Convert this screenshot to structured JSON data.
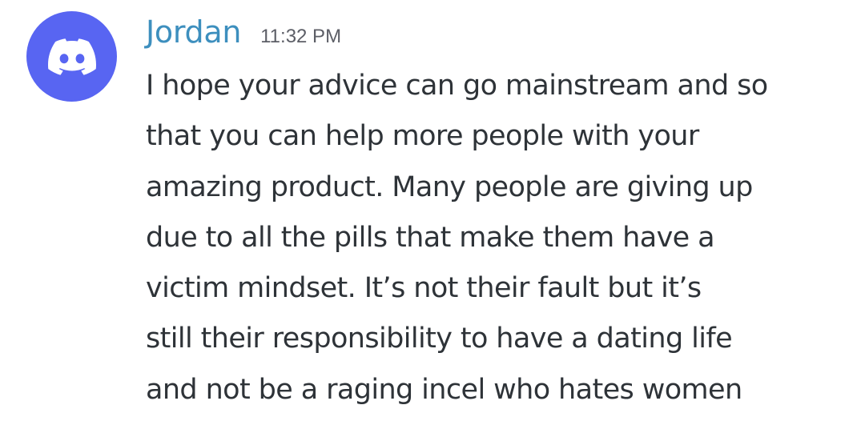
{
  "message": {
    "author": "Jordan",
    "timestamp": "11:32 PM",
    "avatar_icon": "discord-logo-icon",
    "lines": [
      "I hope your advice can go mainstream and so",
      "that you can help more people with your",
      "amazing product. Many people are giving up",
      "due to all the pills that make them have a",
      "victim mindset. It’s not their fault but it’s",
      "still their responsibility to have a dating life",
      "and not be a raging incel who hates women"
    ]
  },
  "colors": {
    "author": "#3d8fbe",
    "avatar_bg": "#5865f2",
    "text": "#2e3338",
    "timestamp": "#5c5e66"
  }
}
